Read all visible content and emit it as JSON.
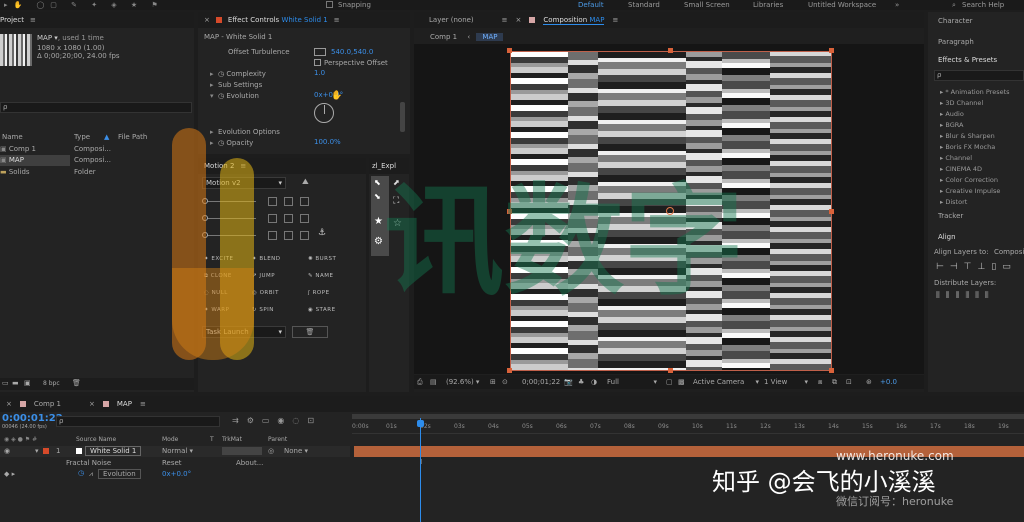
{
  "topbar": {
    "snapping": "Snapping",
    "workspaces": [
      "Default",
      "Standard",
      "Small Screen",
      "Libraries",
      "Untitled Workspace"
    ],
    "search_help": "Search Help"
  },
  "project": {
    "tab": "Project",
    "item_name": "MAP",
    "item_used": ", used 1 time",
    "item_size": "1080 x 1080 (1.00)",
    "item_duration": "Δ 0;00;20;00, 24.00 fps",
    "search_placeholder": "ρ",
    "columns": [
      "Name",
      "Type",
      "File Path"
    ],
    "rows": [
      {
        "name": "Comp 1",
        "type": "Composi..."
      },
      {
        "name": "MAP",
        "type": "Composi..."
      },
      {
        "name": "Solids",
        "type": "Folder"
      }
    ],
    "bpc": "8 bpc"
  },
  "effect_controls": {
    "tab": "Effect Controls",
    "layer": "White Solid 1",
    "header": "MAP - White Solid 1",
    "offset_turbulence": "Offset Turbulence",
    "offset_value": "540.0,540.0",
    "perspective_offset": "Perspective Offset",
    "complexity": "Complexity",
    "complexity_value": "1.0",
    "sub_settings": "Sub Settings",
    "evolution": "Evolution",
    "evolution_value": "0x+0.0°",
    "evolution_options": "Evolution Options",
    "opacity": "Opacity",
    "opacity_value": "100.0%"
  },
  "motion": {
    "tab": "Motion 2",
    "version": "Motion v2",
    "buttons": [
      "EXCITE",
      "BLEND",
      "BURST",
      "CLONE",
      "JUMP",
      "NAME",
      "NULL",
      "ORBIT",
      "ROPE",
      "WARP",
      "SPIN",
      "STARE"
    ],
    "task": "Task Launch"
  },
  "zl": {
    "tab": "zl_Expl"
  },
  "layer_panel": {
    "tab": "Layer (none)"
  },
  "composition": {
    "tab": "Composition",
    "comp_name": "MAP",
    "breadcrumb": [
      "Comp 1",
      "MAP"
    ],
    "zoom": "(92.6%)",
    "time": "0;00;01;22",
    "resolution": "Full",
    "camera": "Active Camera",
    "view": "1 View",
    "exposure": "+0.0"
  },
  "right_panels": {
    "character": "Character",
    "paragraph": "Paragraph",
    "effects_presets": "Effects & Presets",
    "search": "ρ",
    "categories": [
      "* Animation Presets",
      "3D Channel",
      "Audio",
      "BGRA",
      "Blur & Sharpen",
      "Boris FX Mocha",
      "Channel",
      "CINEMA 4D",
      "Color Correction",
      "Creative Impulse",
      "Distort"
    ],
    "tracker": "Tracker",
    "align": "Align",
    "align_layers_to": "Align Layers to:",
    "align_target": "Compositi",
    "distribute_layers": "Distribute Layers:"
  },
  "timeline": {
    "tabs": [
      "Comp 1",
      "MAP"
    ],
    "timecode": "0:00:01:22",
    "timecode_sub": "00046 (24.00 fps)",
    "search": "ρ",
    "columns": [
      "Source Name",
      "Mode",
      "T",
      "TrkMat",
      "Parent"
    ],
    "layer_number": "1",
    "layer_name": "White Solid 1",
    "layer_mode": "Normal",
    "parent_value": "None",
    "effect_name": "Fractal Noise",
    "reset": "Reset",
    "about": "About...",
    "prop_name": "Evolution",
    "prop_value": "0x+0.0°",
    "ruler": [
      "0:00s",
      "01s",
      "02s",
      "03s",
      "04s",
      "05s",
      "06s",
      "07s",
      "08s",
      "09s",
      "10s",
      "11s",
      "12s",
      "13s",
      "14s",
      "15s",
      "16s",
      "17s",
      "18s",
      "19s"
    ]
  },
  "watermarks": {
    "site": "www.heronuke.com",
    "zhihu": "知乎 @会飞的小溪溪",
    "wechat": "微信订阅号：heronuke",
    "logo_text": "讯数字"
  }
}
